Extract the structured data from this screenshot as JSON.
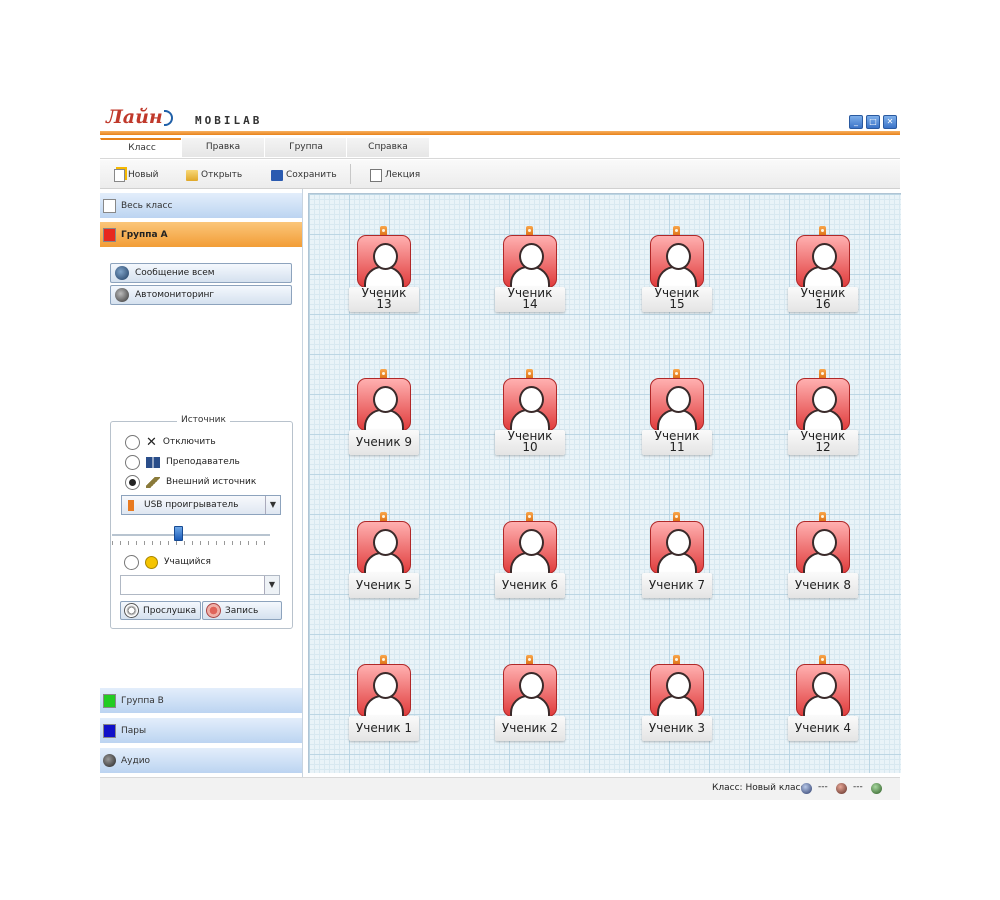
{
  "header": {
    "logo_text": "Лайн",
    "brand": "MOBILAB",
    "window_buttons": [
      "minimize",
      "maximize",
      "close"
    ]
  },
  "tabs": [
    {
      "label": "Класс",
      "active": true
    },
    {
      "label": "Правка",
      "active": false
    },
    {
      "label": "Группа",
      "active": false
    },
    {
      "label": "Справка",
      "active": false
    }
  ],
  "toolbar": {
    "new_label": "Новый",
    "open_label": "Открыть",
    "save_label": "Сохранить",
    "lesson_label": "Лекция"
  },
  "sidebar": {
    "whole_class": "Весь класс",
    "group_a": "Группа А",
    "group_a_color": "#e8281e",
    "message_all": "Сообщение всем",
    "automonitor": "Автомониторинг",
    "source_legend": "Источник",
    "source_options": [
      "Отключить",
      "Преподаватель",
      "Внешний источник"
    ],
    "selected_source": "Внешний источник",
    "device_select": "USB проигрыватель",
    "slider_level": 0.35,
    "student_option": "Учащийся",
    "student_select": "",
    "listen_button": "Прослушка",
    "record_button": "Запись",
    "group_b": "Группа В",
    "group_b_color": "#22cc22",
    "pairs": "Пары",
    "pairs_color": "#1010c8",
    "audio": "Аудио"
  },
  "students": [
    {
      "line1": "Ученик",
      "line2": "13"
    },
    {
      "line1": "Ученик",
      "line2": "14"
    },
    {
      "line1": "Ученик",
      "line2": "15"
    },
    {
      "line1": "Ученик",
      "line2": "16"
    },
    {
      "line1": "Ученик 9",
      "line2": ""
    },
    {
      "line1": "Ученик",
      "line2": "10"
    },
    {
      "line1": "Ученик",
      "line2": "11"
    },
    {
      "line1": "Ученик",
      "line2": "12"
    },
    {
      "line1": "Ученик 5",
      "line2": ""
    },
    {
      "line1": "Ученик 6",
      "line2": ""
    },
    {
      "line1": "Ученик 7",
      "line2": ""
    },
    {
      "line1": "Ученик 8",
      "line2": ""
    },
    {
      "line1": "Ученик 1",
      "line2": ""
    },
    {
      "line1": "Ученик 2",
      "line2": ""
    },
    {
      "line1": "Ученик 3",
      "line2": ""
    },
    {
      "line1": "Ученик 4",
      "line2": ""
    }
  ],
  "status": {
    "class_label": "Класс: Новый класс",
    "indicators": [
      "---",
      "---"
    ]
  }
}
